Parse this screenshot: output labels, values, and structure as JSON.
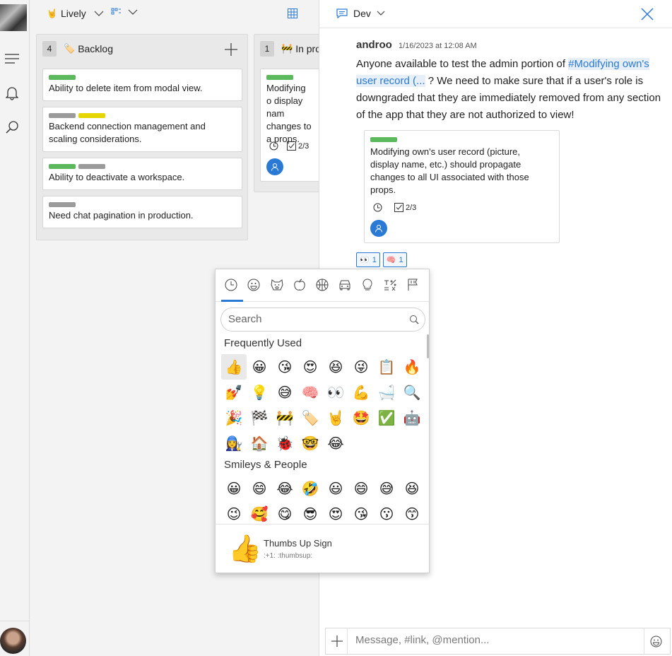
{
  "board": {
    "workspace": {
      "icon": "🤘",
      "name": "Lively"
    },
    "columns": [
      {
        "count": "4",
        "icon": "🏷️",
        "title": "Backlog",
        "cards": [
          {
            "labels": [
              "#5cb85c"
            ],
            "title": "Ability to delete item from modal view."
          },
          {
            "labels": [
              "#9b9b9b",
              "#e6d600"
            ],
            "title": "Backend connection management and scaling considerations."
          },
          {
            "labels": [
              "#5cb85c",
              "#9b9b9b"
            ],
            "title": "Ability to deactivate a workspace."
          },
          {
            "labels": [
              "#9b9b9b"
            ],
            "title": "Need chat pagination in production."
          }
        ]
      },
      {
        "count": "1",
        "icon": "🚧",
        "title": "In pro",
        "cards": [
          {
            "labels": [
              "#5cb85c"
            ],
            "title": "Modifying o display nam changes to a props.",
            "checklist": "2/3"
          }
        ]
      }
    ]
  },
  "chat": {
    "channel": "Dev",
    "message": {
      "author": "androo",
      "time": "1/16/2023 at 12:08 AM",
      "text_before": "Anyone available to test the admin portion of ",
      "link": "#Modifying own's user record (...",
      "text_after": " ? We need to make sure that if a user's role is downgraded that they are immediately removed from any section of the app that they are not authorized to view!",
      "embed": {
        "label_color": "#5cb85c",
        "title": "Modifying own's user record (picture, display name, etc.) should propagate changes to all UI associated with those props.",
        "checklist": "2/3"
      },
      "reactions": [
        {
          "emoji": "👀",
          "count": "1"
        },
        {
          "emoji": "🧠",
          "count": "1"
        }
      ]
    },
    "composer_placeholder": "Message, #link, @mention..."
  },
  "emoji_picker": {
    "categories": [
      "recent-icon",
      "smiley-icon",
      "animal-icon",
      "food-icon",
      "activity-icon",
      "travel-icon",
      "objects-icon",
      "symbols-icon",
      "flags-icon"
    ],
    "search_placeholder": "Search",
    "frequent_label": "Frequently Used",
    "frequent": [
      "👍",
      "😀",
      "😘",
      "😍",
      "😆",
      "😜",
      "📋",
      "🔥",
      "💅",
      "💡",
      "😅",
      "🧠",
      "👀",
      "💪",
      "🛁",
      "🔍",
      "🎉",
      "🏁",
      "🚧",
      "🏷️",
      "🤘",
      "🤩",
      "✅",
      "🤖",
      "👩‍🔧",
      "🏠",
      "🐞",
      "🤓",
      "😂"
    ],
    "smileys_label": "Smileys & People",
    "smileys": [
      "😀",
      "😄",
      "😂",
      "🤣",
      "😃",
      "😄",
      "😅",
      "😆",
      "😉",
      "🥰",
      "😋",
      "😎",
      "😍",
      "😘",
      "😗",
      "😙"
    ],
    "preview": {
      "glyph": "👍",
      "name": "Thumbs Up Sign",
      "codes": ":+1:  :thumbsup:"
    }
  },
  "colors": {
    "accent": "#2a7ad5",
    "green": "#5cb85c",
    "gray": "#9b9b9b",
    "yellow": "#e6d600"
  }
}
